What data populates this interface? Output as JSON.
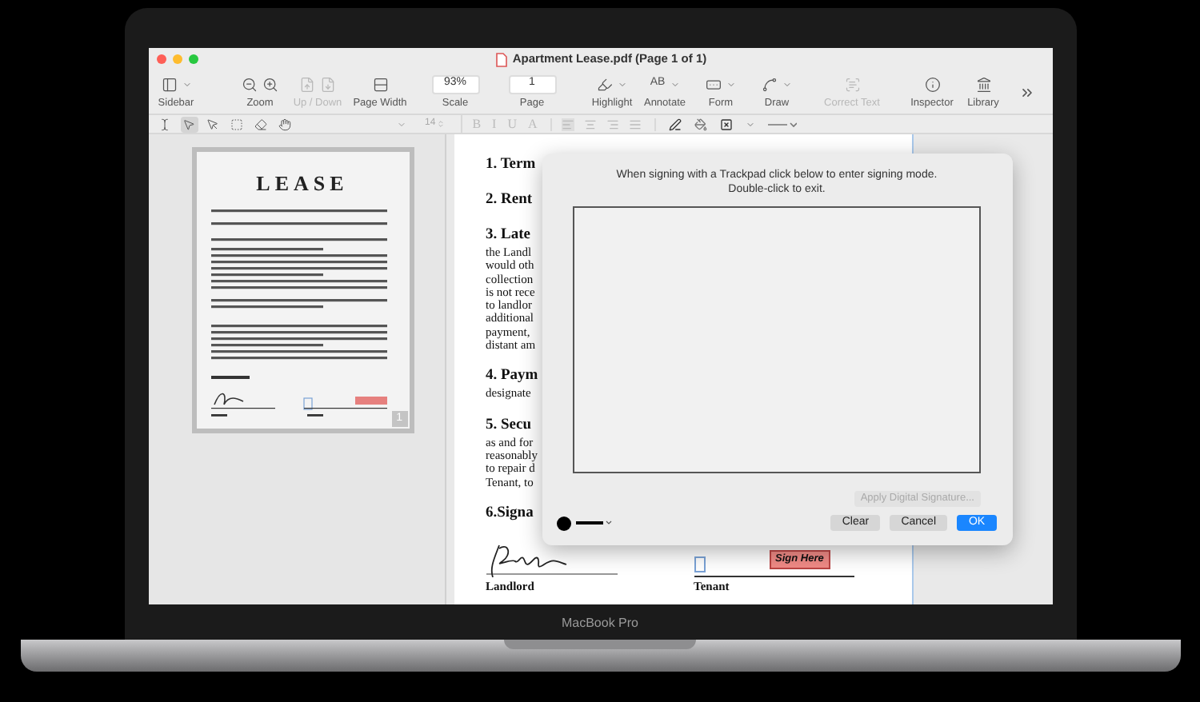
{
  "window": {
    "title": "Apartment Lease.pdf (Page 1 of 1)"
  },
  "toolbar": [
    {
      "label": "Sidebar",
      "kind": "menu",
      "disabled": false
    },
    {
      "label": "Zoom",
      "kind": "pair",
      "disabled": false
    },
    {
      "label": "Up / Down",
      "kind": "pair",
      "disabled": true
    },
    {
      "label": "Page Width",
      "kind": "icon",
      "disabled": false
    },
    {
      "label": "Scale",
      "kind": "field",
      "value": "93%",
      "disabled": false
    },
    {
      "label": "Page",
      "kind": "field",
      "value": "1",
      "disabled": false
    },
    {
      "label": "Highlight",
      "kind": "menu",
      "disabled": false
    },
    {
      "label": "Annotate",
      "kind": "glyph",
      "glyph": "AB",
      "disabled": false
    },
    {
      "label": "Form",
      "kind": "menu",
      "disabled": false
    },
    {
      "label": "Draw",
      "kind": "menu",
      "disabled": false
    },
    {
      "label": "Correct Text",
      "kind": "icon",
      "disabled": true
    },
    {
      "label": "Inspector",
      "kind": "icon",
      "disabled": false
    },
    {
      "label": "Library",
      "kind": "icon",
      "disabled": false
    }
  ],
  "format_bar": {
    "tools": [
      {
        "selected": false
      },
      {
        "selected": true
      },
      {
        "selected": false
      },
      {
        "selected": false
      },
      {
        "selected": false
      },
      {
        "selected": false
      }
    ],
    "font_size": "14",
    "styles": [
      "B",
      "I",
      "U",
      "A"
    ]
  },
  "thumbnail": {
    "title": "LEASE",
    "page_number": "1"
  },
  "document": {
    "sections": [
      {
        "heading": "1. Term"
      },
      {
        "heading": "2. Rent"
      },
      {
        "heading": "3. Late",
        "lines": [
          "the Landl",
          "would oth",
          "collection",
          "is not rece",
          "to landlor",
          "additional",
          "payment,",
          "distant am"
        ]
      },
      {
        "heading": "4. Paym",
        "lines": [
          "designate"
        ]
      },
      {
        "heading": "5. Secu",
        "lines": [
          "as and for",
          "reasonably",
          "to repair d",
          "Tenant, to"
        ]
      },
      {
        "heading": "6.Signa"
      }
    ],
    "landlord_label": "Landlord",
    "tenant_label": "Tenant",
    "sign_here": "Sign Here"
  },
  "dialog": {
    "instructions": [
      "When signing with a Trackpad click below to enter signing mode.",
      "Double-click to exit."
    ],
    "apply_button": {
      "label": "Apply Digital Signature...",
      "disabled": true
    },
    "buttons": [
      {
        "label": "Clear",
        "kind": "secondary"
      },
      {
        "label": "Cancel",
        "kind": "secondary"
      },
      {
        "label": "OK",
        "kind": "primary"
      }
    ]
  },
  "laptop": {
    "label": "MacBook Pro"
  }
}
